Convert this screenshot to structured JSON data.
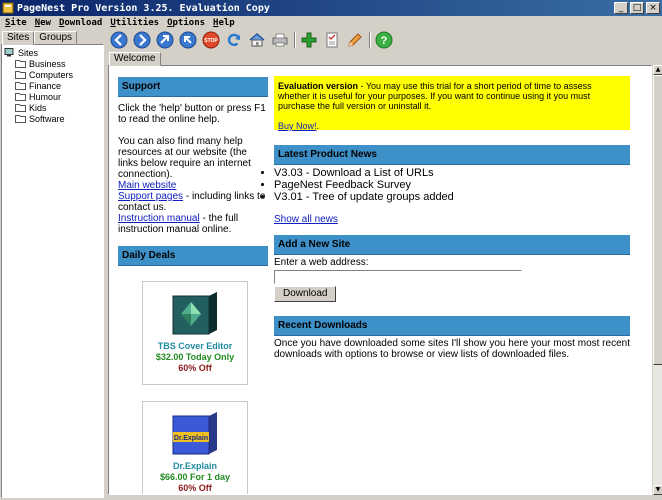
{
  "window": {
    "title": "PageNest Pro Version 3.25. Evaluation Copy",
    "minimize_glyph": "_",
    "maximize_glyph": "□",
    "close_glyph": "×"
  },
  "menu": [
    "Site",
    "New",
    "Download",
    "Utilities",
    "Options",
    "Help"
  ],
  "left_tabs": [
    "Sites",
    "Groups"
  ],
  "tree": {
    "root": "Sites",
    "children": [
      "Business",
      "Computers",
      "Finance",
      "Humour",
      "Kids",
      "Software"
    ]
  },
  "toolbar": {
    "icons": [
      "back-icon",
      "forward-icon",
      "up-icon",
      "home-up-icon",
      "stop-icon",
      "refresh-icon",
      "home-icon",
      "print-icon",
      "add-site-icon",
      "checklist-icon",
      "pencil-icon",
      "help-icon"
    ],
    "stop_label": "STOP"
  },
  "content_tab": "Welcome",
  "support": {
    "heading": "Support",
    "p1": "Click the 'help' button or press F1 to read the online help.",
    "p2": "You can also find many help resources at our website (the links below require an internet connection).",
    "link_main": "Main website",
    "link_support": "Support pages",
    "support_suffix": " - including links to contact us.",
    "link_manual": "Instruction manual",
    "manual_suffix": " - the full instruction manual online."
  },
  "deals": {
    "heading": "Daily Deals",
    "items": [
      {
        "name": "TBS Cover Editor",
        "price": "$32.00 Today Only",
        "discount": "60% Off"
      },
      {
        "name": "Dr.Explain",
        "price": "$66.00 For 1 day",
        "discount": "60% Off",
        "box_label": "Dr.Explain"
      }
    ]
  },
  "evaluation": {
    "bold": "Evaluation version",
    "text": " - You may use this trial for a short period of time to assess whether it is useful for your purposes. If you want to continue using it you must purchase the full version or uninstall it.",
    "buy_link": "Buy Now!",
    "buy_suffix": "."
  },
  "news": {
    "heading": "Latest Product News",
    "items": [
      "V3.03 - Download a List of URLs",
      "PageNest Feedback Survey",
      "V3.01 - Tree of update groups added"
    ],
    "show_all": "Show all news"
  },
  "add_site": {
    "heading": "Add a New Site",
    "label": "Enter a web address:",
    "input_value": "",
    "button": "Download"
  },
  "recent": {
    "heading": "Recent Downloads",
    "text": "Once you have downloaded some sites I'll show you here your most most recent downloads with options to browse or view lists of downloaded files."
  },
  "colors": {
    "title_gradient_start": "#0a246a",
    "title_gradient_end": "#3a6ea5",
    "section_header": "#3e90c9",
    "eval_background": "#ffff00",
    "link": "#1020c0"
  }
}
